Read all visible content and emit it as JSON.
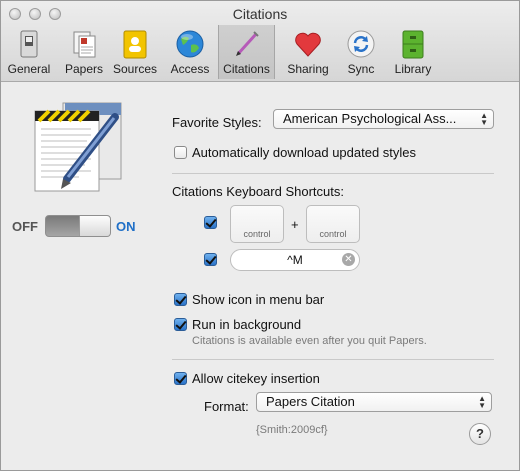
{
  "window": {
    "title": "Citations"
  },
  "toolbar": {
    "tabs": [
      {
        "label": "General",
        "icon": "switch-icon"
      },
      {
        "label": "Papers",
        "icon": "papers-icon"
      },
      {
        "label": "Sources",
        "icon": "sources-icon"
      },
      {
        "label": "Access",
        "icon": "globe-icon"
      },
      {
        "label": "Citations",
        "icon": "pen-icon",
        "selected": true
      },
      {
        "label": "Sharing",
        "icon": "heart-icon"
      },
      {
        "label": "Sync",
        "icon": "sync-icon"
      },
      {
        "label": "Library",
        "icon": "cabinet-icon"
      }
    ]
  },
  "toggle": {
    "off_label": "OFF",
    "on_label": "ON",
    "state": "on"
  },
  "favorite_styles": {
    "label": "Favorite Styles:",
    "value": "American Psychological Ass..."
  },
  "auto_download": {
    "label": "Automatically download updated styles",
    "checked": false
  },
  "shortcuts": {
    "heading": "Citations Keyboard Shortcuts:",
    "key1": "control",
    "plus": "+",
    "key2": "control",
    "field_value": "^M",
    "checked1": true,
    "checked2": true
  },
  "show_icon": {
    "label": "Show icon in menu bar",
    "checked": true
  },
  "run_background": {
    "label": "Run in background",
    "checked": true,
    "note": "Citations is available even after you quit Papers."
  },
  "citekey": {
    "label": "Allow citekey insertion",
    "checked": true
  },
  "format": {
    "label": "Format:",
    "value": "Papers Citation",
    "example": "{Smith:2009cf}"
  },
  "help": {
    "label": "?"
  },
  "colors": {
    "accent_blue": "#2a73c9",
    "on_label": "#1f6fc7"
  }
}
